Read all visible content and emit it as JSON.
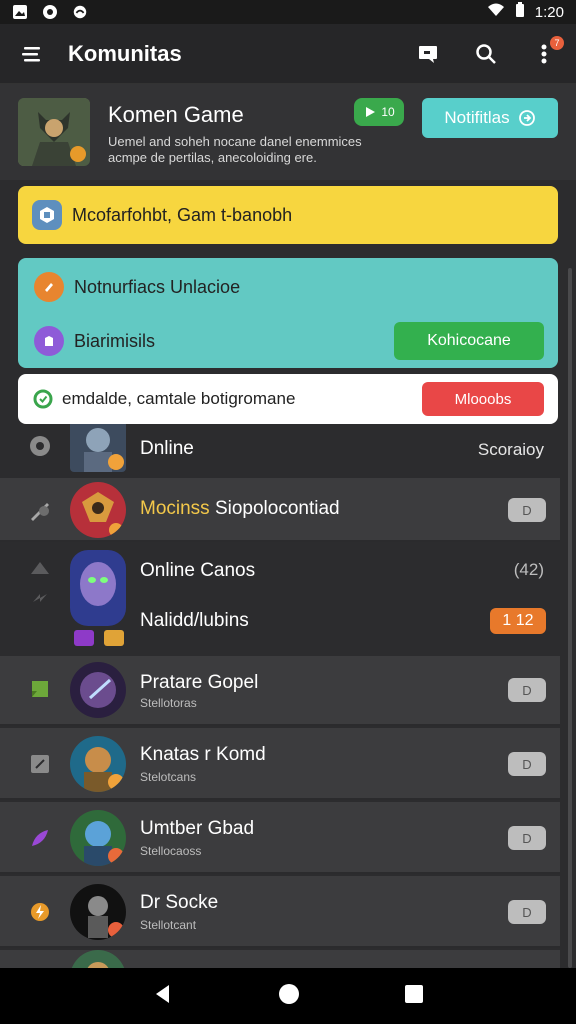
{
  "status_bar": {
    "time": "1:20"
  },
  "app_bar": {
    "title": "Komunitas",
    "notification_count": "7"
  },
  "header": {
    "game_title": "Komen Game",
    "description": "Uemel and soheh nocane danel enemmices acmpe de pertilas, anecoloiding ere.",
    "live_label": "10",
    "notif_button_label": "Notifitlas"
  },
  "banners": {
    "yellow_text": "Mcofarfohbt, Gam t-banobh",
    "teal_row1_text": "Notnurfiacs Unlacioe",
    "teal_row2_text": "Biarimisils",
    "teal_button_label": "Kohicocane",
    "white_text": "emdalde, camtale botigromane",
    "white_button_label": "Mlooobs"
  },
  "list": {
    "row0": {
      "name": "Dnline",
      "right": "Scoraioy"
    },
    "row1": {
      "name_prefix": "Mocinss",
      "name_rest": " Siopolocontiad",
      "pill": "D"
    },
    "row2": {
      "name": "Online Canos",
      "right": "(42)",
      "name2": "Nalidd/lubins",
      "pill": "1 12"
    },
    "row3": {
      "name": "Pratare Gopel",
      "sub": "Stellotoras",
      "pill": "D"
    },
    "row4": {
      "name": "Knatas r Komd",
      "sub": "Stelotcans",
      "pill": "D"
    },
    "row5": {
      "name": "Umtber Gbad",
      "sub": "Stellocaoss",
      "pill": "D"
    },
    "row6": {
      "name": "Dr Socke",
      "sub": "Stellotcant",
      "pill": "D"
    }
  },
  "colors": {
    "accent_teal": "#58cfcb",
    "yellow": "#f7d63f",
    "green": "#33b04e",
    "red": "#e94747",
    "orange": "#e8792b"
  }
}
